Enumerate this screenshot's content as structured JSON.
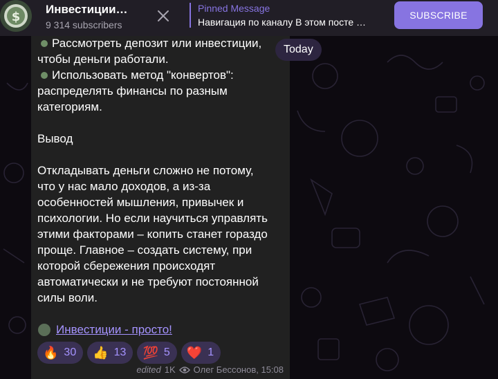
{
  "header": {
    "title": "Инвестиции…",
    "subscribers": "9 314 subscribers",
    "pinned_title": "Pinned Message",
    "pinned_text": "Навигация по каналу В этом посте …",
    "subscribe_label": "SUBSCRIBE"
  },
  "date_badge": "Today",
  "message": {
    "lines": [
      "Рассмотреть депозит или инвестиции,",
      "чтобы деньги работали.",
      "Использовать метод \"конвертов\":",
      "распределять финансы по разным",
      "категориям.",
      "Вывод",
      "Откладывать деньги сложно не потому,",
      "что у нас мало доходов, а из-за",
      "особенностей мышления, привычек и",
      "психологии. Но если научиться управлять",
      "этими факторами – копить станет гораздо",
      "проще. Главное – создать систему, при",
      "которой сбережения происходят",
      "автоматически и не требуют постоянной",
      "силы воли."
    ],
    "signature_link": "Инвестиции - просто!",
    "reactions": [
      {
        "emoji": "🔥",
        "count": "30"
      },
      {
        "emoji": "👍",
        "count": "13"
      },
      {
        "emoji": "💯",
        "count": "5"
      },
      {
        "emoji": "❤️",
        "count": "1"
      }
    ],
    "edited_label": "edited",
    "views": "1K",
    "author_time": "Олег Бессонов, 15:08"
  },
  "colors": {
    "accent": "#8774e1",
    "bubble": "#212121",
    "header": "#211e26",
    "link": "#a593ff"
  }
}
